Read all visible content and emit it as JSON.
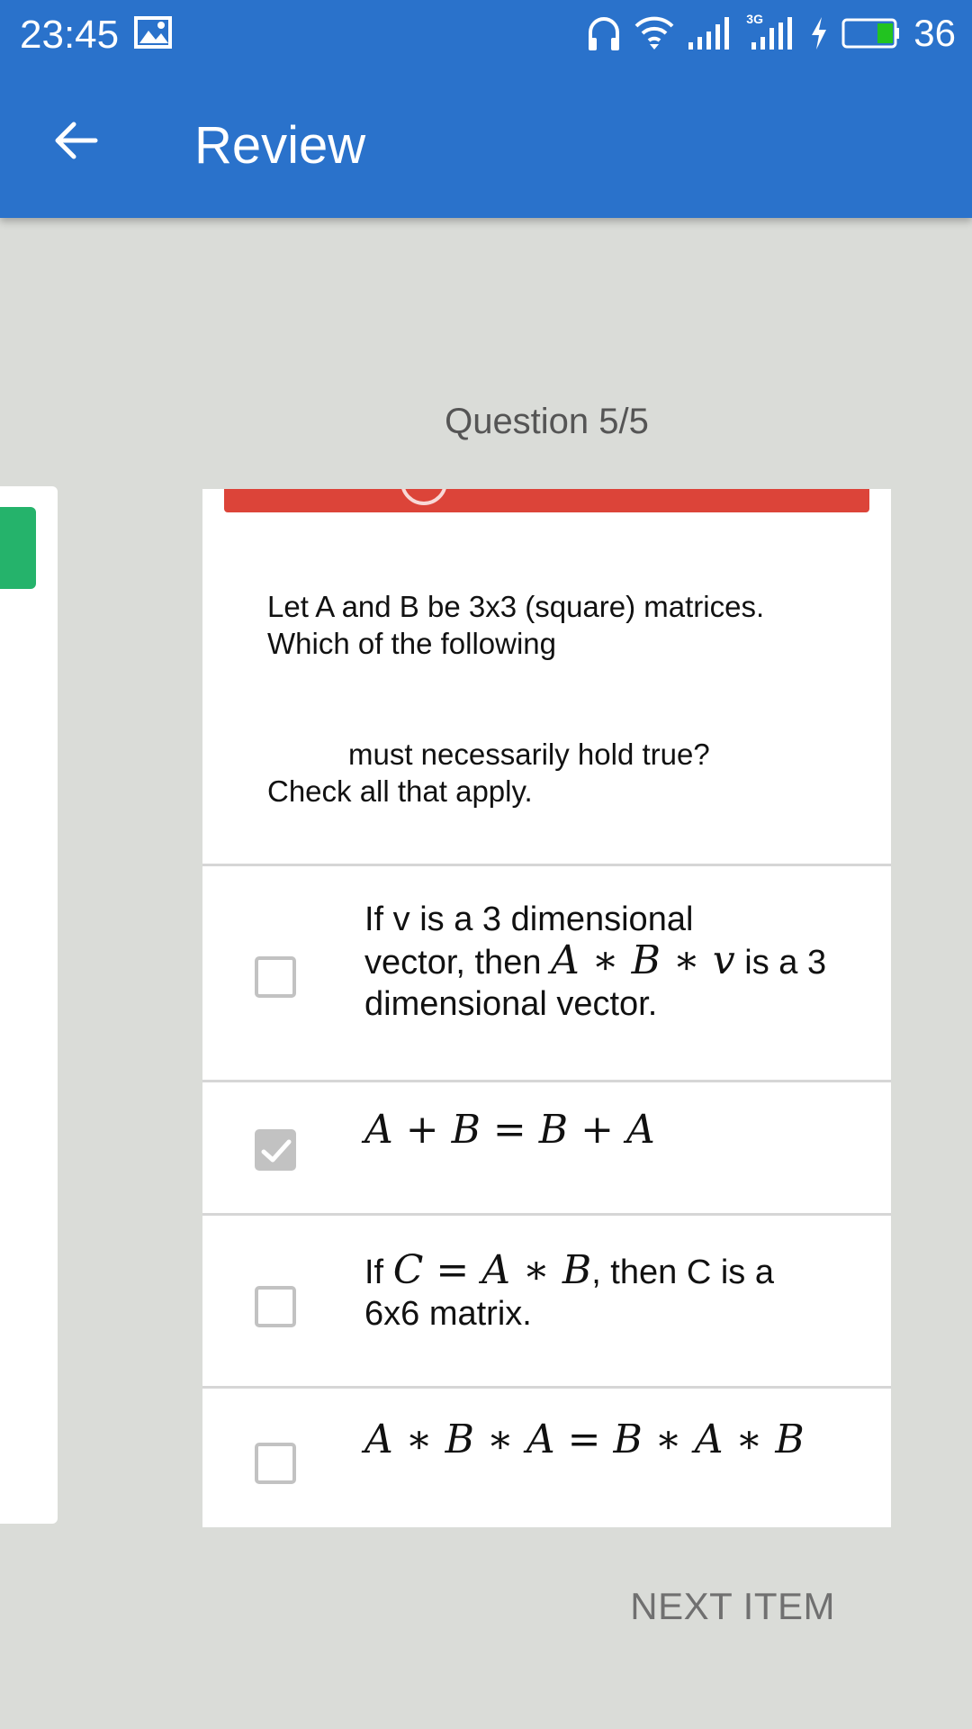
{
  "status_bar": {
    "time": "23:45",
    "network": "3G",
    "battery": "36"
  },
  "appbar": {
    "title": "Review"
  },
  "question": {
    "counter": "Question 5/5",
    "prompt_line1": "Let A and B be 3x3 (square) matrices.",
    "prompt_line2": "Which of the following",
    "prompt_line3": "must necessarily hold true?",
    "prompt_line4": "Check all that apply."
  },
  "options": [
    {
      "line1": "If v is a 3 dimensional",
      "line2_pre": "vector, then ",
      "line2_math": "A ∗ B ∗ v",
      "line2_post": " is a 3",
      "line3": "dimensional vector.",
      "checked": false
    },
    {
      "math": "A + B = B + A",
      "checked": true
    },
    {
      "pre": "If ",
      "math": "C = A ∗ B",
      "post": ", then C is a",
      "line2": "6x6 matrix.",
      "checked": false
    },
    {
      "math": "A ∗ B ∗ A = B ∗ A ∗ B",
      "checked": false
    }
  ],
  "footer": {
    "next_label": "NEXT ITEM"
  },
  "colors": {
    "appbar": "#2a72cb",
    "background": "#dadcd8",
    "banner": "#dc4439",
    "prev_card_accent": "#25b36b",
    "checkbox": "#c2c2c2"
  }
}
